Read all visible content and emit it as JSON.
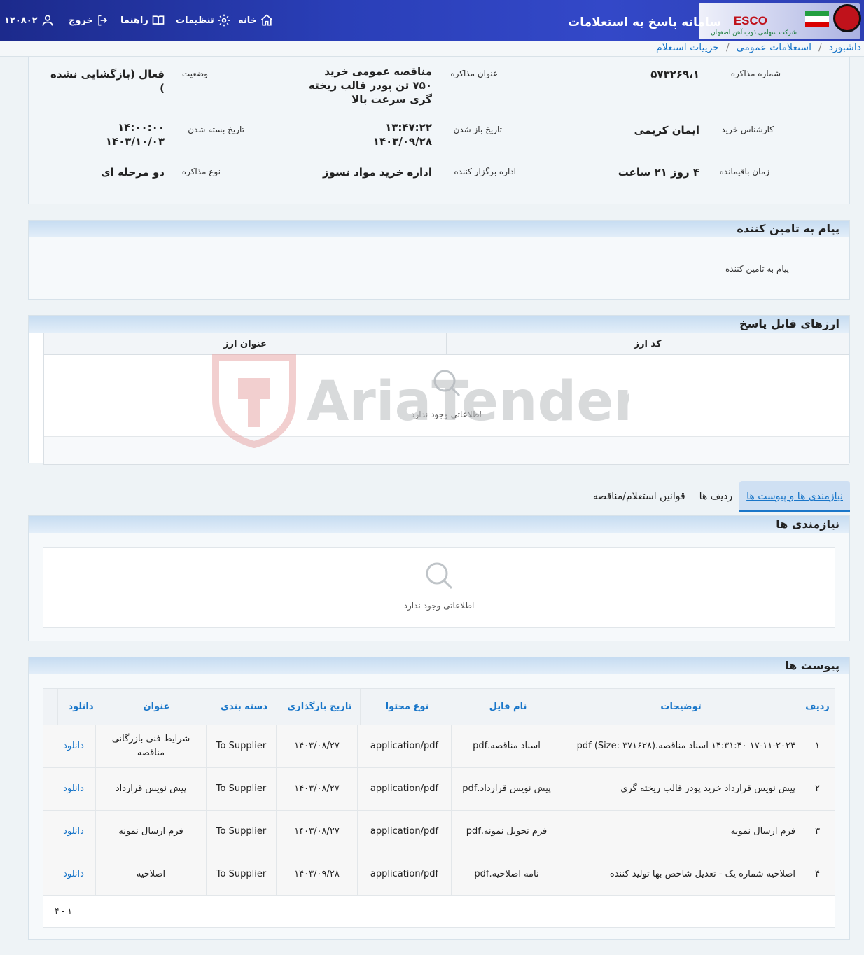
{
  "header": {
    "system_title": "سامانه پاسخ به استعلامات",
    "brand_name": "ESCO",
    "company_name": "شرکت سهامی ذوب آهن اصفهان",
    "nav": {
      "home": "خانه",
      "settings": "تنظیمات",
      "guide": "راهنما",
      "logout": "خروج",
      "user_id": "۱۲۰۸۰۲"
    }
  },
  "breadcrumb": {
    "items": [
      "داشبورد",
      "استعلامات عمومی",
      "جزییات استعلام"
    ],
    "separator": "/"
  },
  "details": {
    "negotiation_number_label": "شماره مذاکره",
    "negotiation_number": "۵۷۳۲۶۹،۱",
    "negotiation_title_label": "عنوان مذاکره",
    "negotiation_title": "مناقصه عمومی خرید ۷۵۰ تن پودر قالب ریخته گری سرعت بالا",
    "status_label": "وضعیت",
    "status": "فعال (بازگشایی نشده )",
    "buyer_expert_label": "کارشناس خرید",
    "buyer_expert": "ایمان کریمی",
    "opening_date_label": "تاریخ باز شدن",
    "opening_time": "۱۳:۴۷:۲۲",
    "opening_date": "۱۴۰۳/۰۹/۲۸",
    "closing_date_label": "تاریخ بسته شدن",
    "closing_time": "۱۴:۰۰:۰۰",
    "closing_date": "۱۴۰۳/۱۰/۰۳",
    "remaining_time_label": "زمان باقیمانده",
    "remaining_time": "۴ روز ۲۱ ساعت",
    "organizer_label": "اداره برگزار کننده",
    "organizer": "اداره خرید مواد نسوز",
    "negotiation_type_label": "نوع مذاکره",
    "negotiation_type": "دو مرحله ای"
  },
  "supplier_message": {
    "title": "پیام به تامین کننده",
    "label": "پیام به تامین کننده"
  },
  "currencies": {
    "title": "ارزهای قابل پاسخ",
    "columns": [
      "کد ارز",
      "عنوان ارز"
    ],
    "empty_text": "اطلاعاتی وجود ندارد"
  },
  "tabs": [
    "نیازمندی ها و پیوست ها",
    "ردیف ها",
    "قوانین استعلام/مناقصه"
  ],
  "needs": {
    "title": "نیازمندی ها",
    "empty_text": "اطلاعاتی وجود ندارد"
  },
  "attachments": {
    "title": "پیوست ها",
    "columns": [
      "ردیف",
      "توضیحات",
      "نام فایل",
      "نوع محتوا",
      "تاریخ بارگذاری",
      "دسته بندی",
      "عنوان",
      "دانلود"
    ],
    "rows": [
      {
        "row": "۱",
        "description": "۱۷-۱۱-۲۰۲۴ ۱۴:۳۱:۴۰ اسناد مناقصه.pdf (Size: ۳۷۱۶۲۸)",
        "file": "اسناد مناقصه.pdf",
        "type": "application/pdf",
        "date": "۱۴۰۳/۰۸/۲۷",
        "category": "To Supplier",
        "title": "شرایط فنی بازرگانی مناقصه",
        "download": "دانلود"
      },
      {
        "row": "۲",
        "description": "پیش نویس قرارداد خرید پودر قالب ریخته گری",
        "file": "پیش نویس قرارداد.pdf",
        "type": "application/pdf",
        "date": "۱۴۰۳/۰۸/۲۷",
        "category": "To Supplier",
        "title": "پیش نویس قرارداد",
        "download": "دانلود"
      },
      {
        "row": "۳",
        "description": "فرم ارسال نمونه",
        "file": "فرم تحویل نمونه.pdf",
        "type": "application/pdf",
        "date": "۱۴۰۳/۰۸/۲۷",
        "category": "To Supplier",
        "title": "فرم ارسال نمونه",
        "download": "دانلود"
      },
      {
        "row": "۴",
        "description": "اصلاحیه شماره یک - تعدیل شاخص بها تولید کننده",
        "file": "نامه اصلاحیه.pdf",
        "type": "application/pdf",
        "date": "۱۴۰۳/۰۹/۲۸",
        "category": "To Supplier",
        "title": "اصلاحیه",
        "download": "دانلود"
      }
    ],
    "pagination": "۱ - ۴"
  },
  "watermark": "AriaTender.neT",
  "colors": {
    "topbar": "#2a3fb8",
    "link": "#1976c9",
    "panel_head": "#c6dcf1"
  }
}
